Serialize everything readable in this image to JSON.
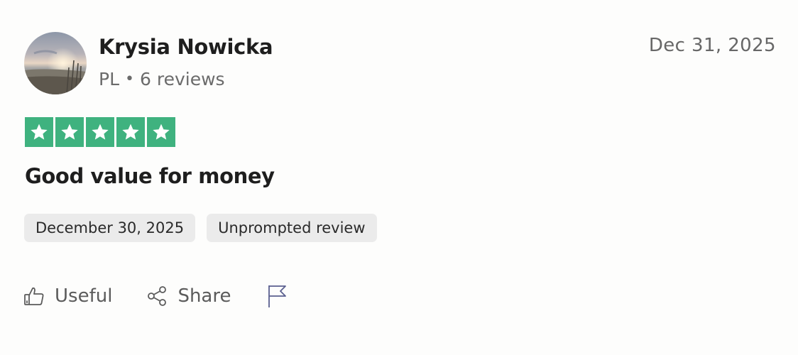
{
  "reviewer": {
    "name": "Krysia Nowicka",
    "country": "PL",
    "separator": "•",
    "reviews": "6 reviews",
    "avatar_icon": "beach-sunset-photo"
  },
  "review": {
    "date": "Dec 31, 2025",
    "rating": 5,
    "rating_max": 5,
    "title": "Good value for money",
    "tags": [
      "December 30, 2025",
      "Unprompted review"
    ]
  },
  "actions": {
    "useful_label": "Useful",
    "share_label": "Share",
    "useful_icon": "thumbs-up-icon",
    "share_icon": "share-icon",
    "report_icon": "flag-icon"
  },
  "colors": {
    "star_green": "#3fb27f",
    "tag_bg": "#ebebeb",
    "muted_text": "#6b6b6b",
    "flag_stroke": "#5a5f8f"
  }
}
